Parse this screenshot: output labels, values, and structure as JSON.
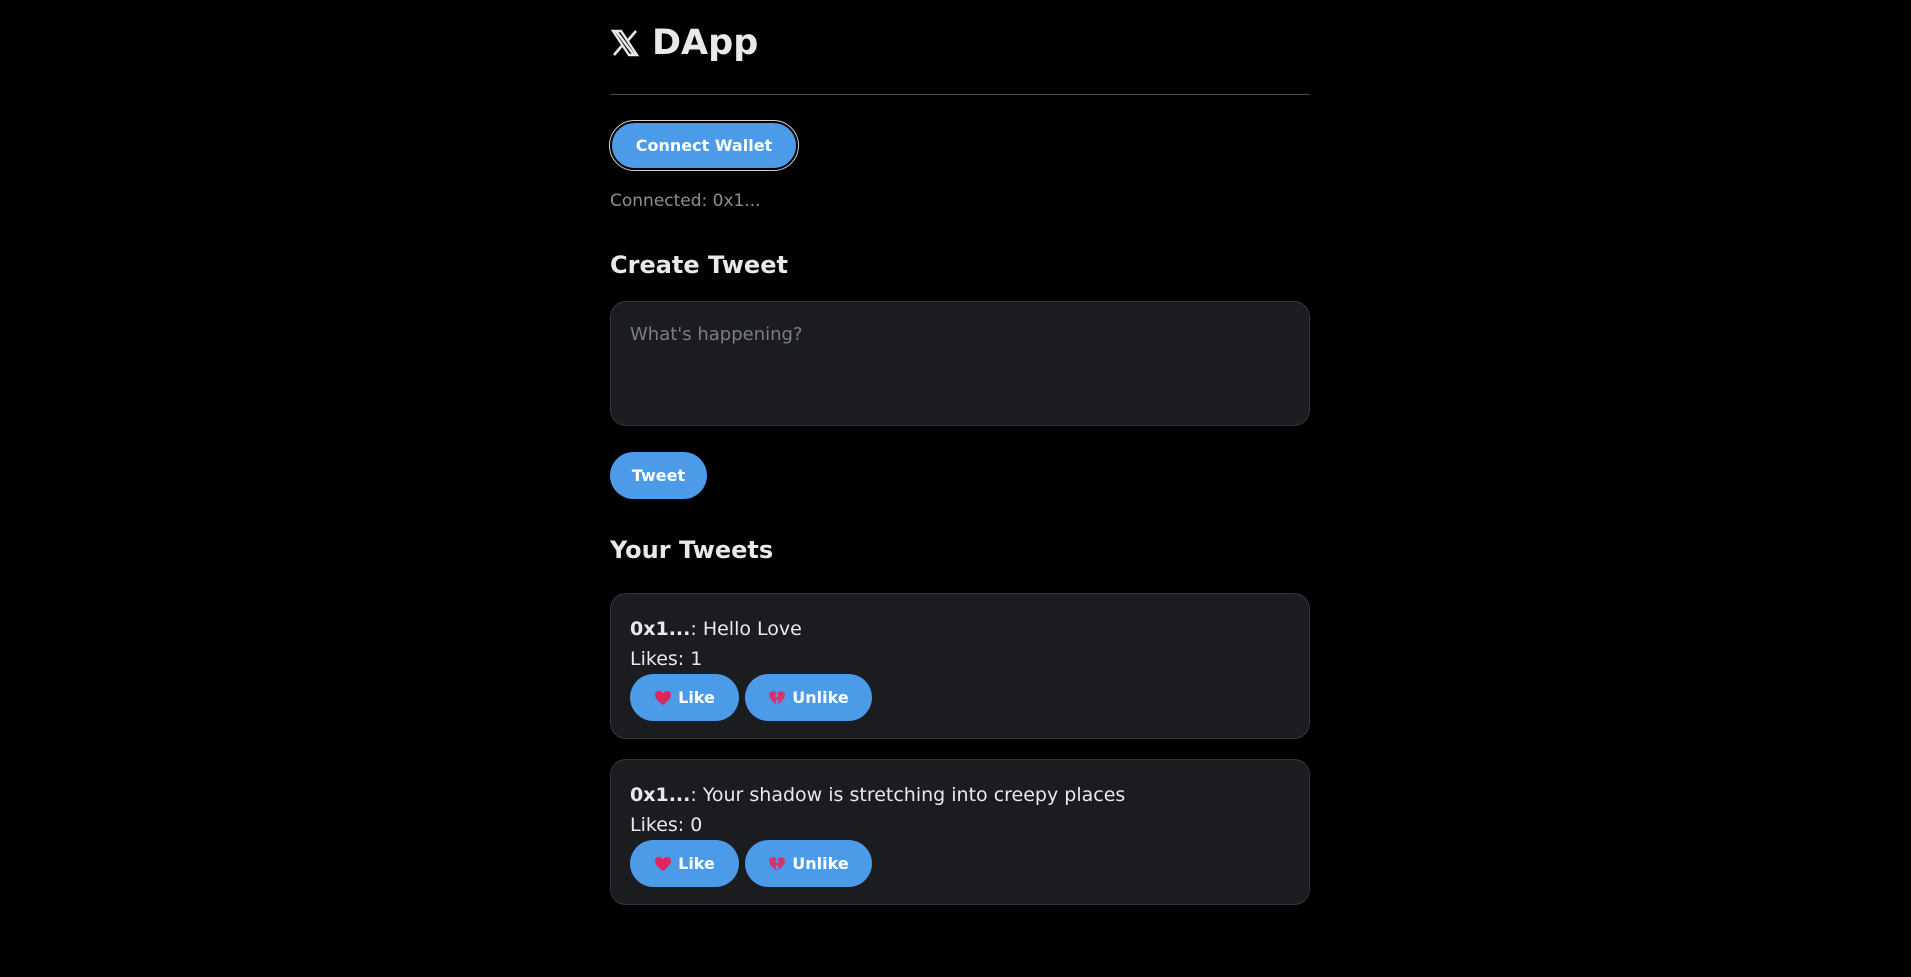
{
  "app": {
    "title": "DApp",
    "logo_icon": "x-logo-icon"
  },
  "wallet": {
    "connect_label": "Connect Wallet",
    "status_text": "Connected: 0x1..."
  },
  "create": {
    "heading": "Create Tweet",
    "placeholder": "What's happening?",
    "value": "",
    "submit_label": "Tweet"
  },
  "feed": {
    "heading": "Your Tweets",
    "tweets": [
      {
        "author": "0x1...",
        "separator": ": ",
        "content": "Hello Love",
        "likes_text": "Likes: 1",
        "like_label": "Like",
        "unlike_label": "Unlike"
      },
      {
        "author": "0x1...",
        "separator": ": ",
        "content": "Your shadow is stretching into creepy places",
        "likes_text": "Likes: 0",
        "like_label": "Like",
        "unlike_label": "Unlike"
      }
    ]
  },
  "colors": {
    "background": "#000000",
    "card": "#1a1c20",
    "accent": "#4c9be8",
    "muted_text": "#8b8f94",
    "like_heart": "#e0245e",
    "unlike_heart": "#d6336c"
  },
  "icons": {
    "like": "red-heart-icon",
    "unlike": "broken-heart-icon"
  }
}
